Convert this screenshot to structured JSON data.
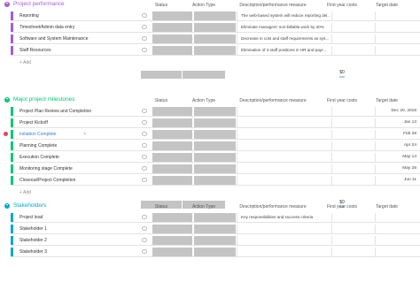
{
  "colors": {
    "purple": "#a25ddc",
    "green": "#00c875",
    "teal": "#00a9cc",
    "gray_cell": "#c4c4c4",
    "link": "#3a7bd5"
  },
  "columns": {
    "status": "Status",
    "action": "Action Type",
    "desc": "Description/performance measure",
    "cost": "First year costs",
    "date": "Target date"
  },
  "groups": [
    {
      "title": "Project performance",
      "color": "#a25ddc",
      "rows": [
        {
          "name": "Reporting",
          "desc": "The web-based system will reduce reporting del...",
          "date": ""
        },
        {
          "name": "Timesheet/Admin data entry",
          "desc": "Eliminate managers' non-billable work by 20%",
          "date": ""
        },
        {
          "name": "Software and System Maintenance",
          "desc": "Decrease in cost and staff requirements as sys...",
          "date": ""
        },
        {
          "name": "Staff Resources",
          "desc": "Elimination of 3 staff positions in HR and payr...",
          "date": ""
        }
      ],
      "add_label": "+ Add",
      "sum_value": "$0",
      "sum_label": "sum"
    },
    {
      "title": "Major project milestones",
      "color": "#00c875",
      "rows": [
        {
          "name": "Project Plan Review and Completion",
          "desc": "",
          "date": "Dec 20, 2019"
        },
        {
          "name": "Project Kickoff",
          "desc": "",
          "date": "Jan 13"
        },
        {
          "name": "Initiation Complete",
          "desc": "",
          "date": "Feb 28"
        },
        {
          "name": "Planning Complete",
          "desc": "",
          "date": "Apr 24"
        },
        {
          "name": "Execution Complete",
          "desc": "",
          "date": "May 14"
        },
        {
          "name": "Monitoring stage Complete",
          "desc": "",
          "date": "May 28"
        },
        {
          "name": "Closeout/Project Completion",
          "desc": "",
          "date": "Jun 11"
        }
      ],
      "add_label": "+ Add",
      "sum_value": "$0",
      "sum_label": "sum"
    },
    {
      "title": "Stakeholders",
      "color": "#00a9cc",
      "rows": [
        {
          "name": "Project lead",
          "desc": "Key responsibilities and success criteria",
          "date": ""
        },
        {
          "name": "Stakeholder 1",
          "desc": "",
          "date": ""
        },
        {
          "name": "Stakeholder 2",
          "desc": "",
          "date": ""
        },
        {
          "name": "Stakeholder 3",
          "desc": "",
          "date": ""
        }
      ]
    }
  ]
}
